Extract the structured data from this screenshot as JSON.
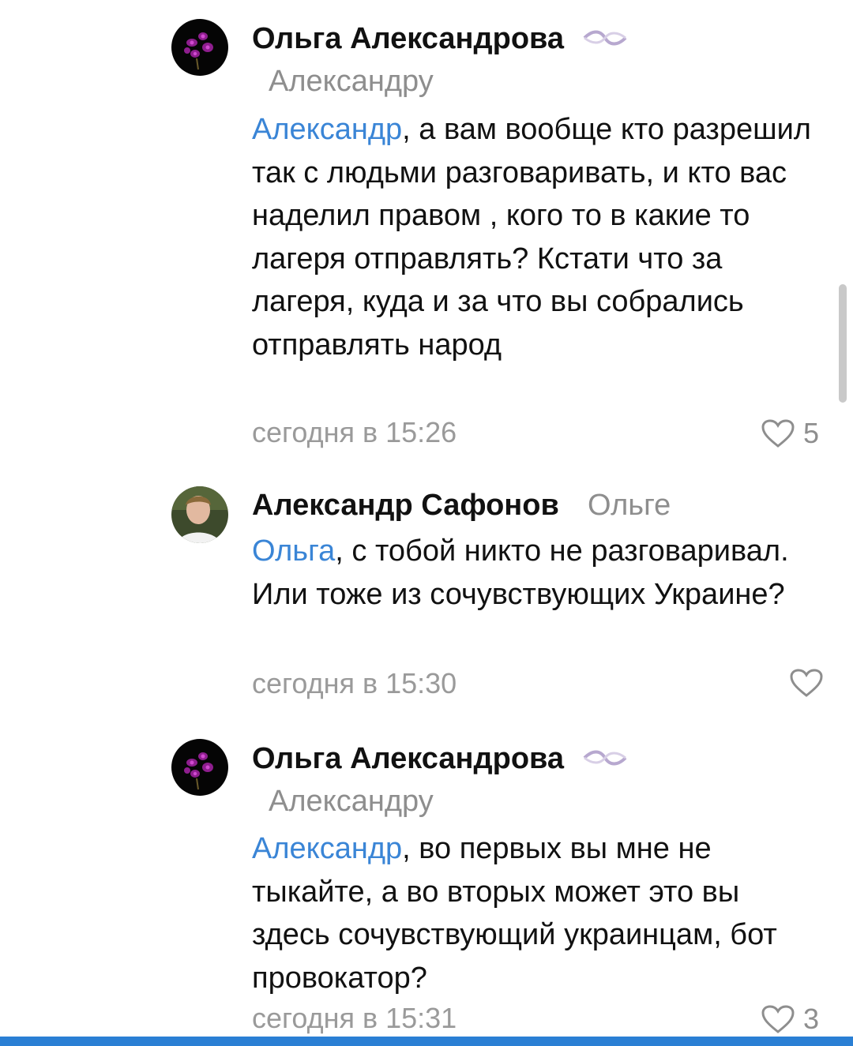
{
  "comments": [
    {
      "author": "Ольга Александрова",
      "reply_to": "Александру",
      "mention": "Александр",
      "text": ", а вам вообще кто разрешил так с людьми разговаривать, и кто вас наделил правом , кого то в какие то лагеря отправлять? Кстати что за лагеря, куда и за что вы собрались отправлять народ",
      "time": "сегодня в 15:26",
      "likes": "5"
    },
    {
      "author": "Александр Сафонов",
      "reply_to": "Ольге",
      "mention": "Ольга",
      "text": ", с тобой никто не разговаривал. Или тоже из сочувствующих Украине?",
      "time": "сегодня в 15:30",
      "likes": ""
    },
    {
      "author": "Ольга Александрова",
      "reply_to": "Александру",
      "mention": "Александр",
      "text": ", во первых вы мне не тыкайте, а во вторых может это вы здесь сочувствующий украинцам, бот провокатор?",
      "time": "сегодня в 15:31",
      "likes": "3"
    }
  ],
  "icons": {
    "avatar_orchid": "orchid-avatar",
    "avatar_person": "person-avatar",
    "ribbon": "ribbon-icon",
    "like": "heart-icon"
  },
  "colors": {
    "mention": "#3a85d6",
    "meta": "#9a9a9a",
    "bottom_bar": "#2a7fd4"
  }
}
